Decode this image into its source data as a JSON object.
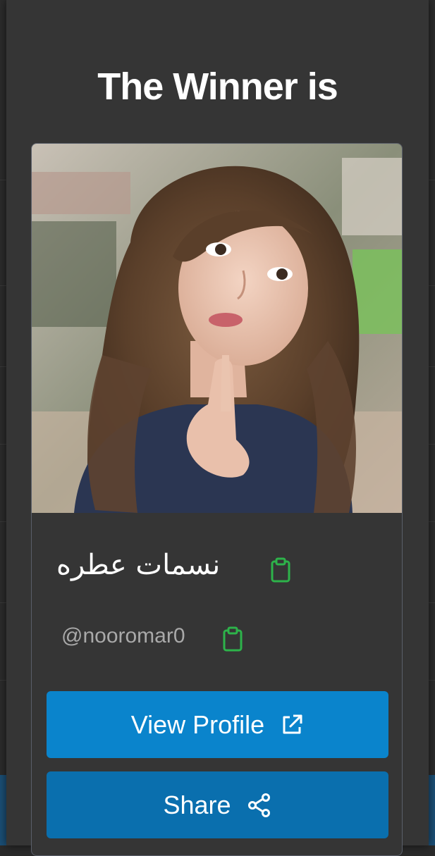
{
  "modal": {
    "title": "The Winner is"
  },
  "winner": {
    "display_name": "نسمات عطره",
    "username": "@nooromar0",
    "photo_alt": "Winner profile photo",
    "copy_name_icon": "clipboard-icon",
    "copy_username_icon": "clipboard-icon"
  },
  "actions": {
    "view_profile_label": "View Profile",
    "view_profile_icon": "external-link-icon",
    "share_label": "Share",
    "share_icon": "share-icon"
  },
  "colors": {
    "modal_bg": "#353535",
    "primary_button": "#0a84cc",
    "secondary_button": "#0a6fae",
    "clipboard_icon": "#2db34a",
    "title_text": "#ffffff",
    "username_text": "#a9a9a9"
  }
}
